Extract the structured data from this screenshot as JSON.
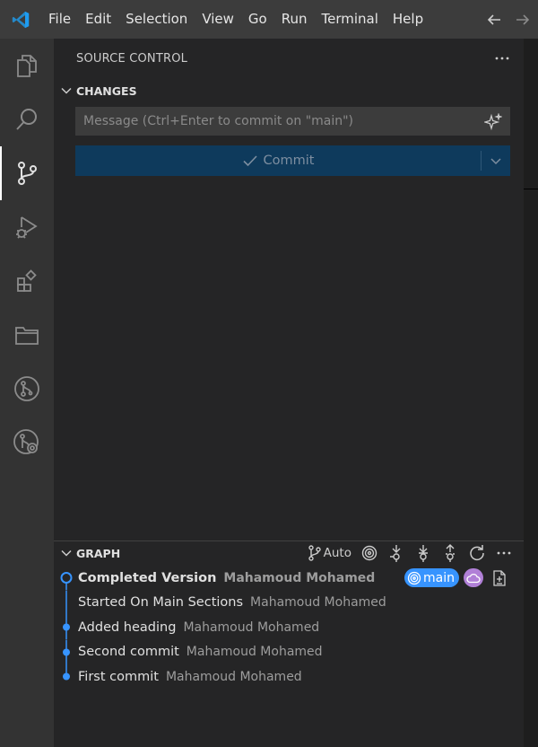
{
  "menu": {
    "items": [
      "File",
      "Edit",
      "Selection",
      "View",
      "Go",
      "Run",
      "Terminal",
      "Help"
    ]
  },
  "activity": {
    "items": [
      {
        "name": "explorer-icon"
      },
      {
        "name": "search-icon"
      },
      {
        "name": "source-control-icon",
        "active": true
      },
      {
        "name": "run-debug-icon"
      },
      {
        "name": "extensions-icon"
      },
      {
        "name": "remote-explorer-icon"
      },
      {
        "name": "github-pr-icon"
      },
      {
        "name": "git-graph-icon"
      }
    ]
  },
  "sidebar": {
    "title": "SOURCE CONTROL",
    "changes_label": "CHANGES",
    "commit": {
      "placeholder": "Message (Ctrl+Enter to commit on \"main\")",
      "button_label": "Commit"
    },
    "graph": {
      "label": "GRAPH",
      "auto_label": "Auto",
      "branch_badge": "main",
      "commits": [
        {
          "message": "Completed Version",
          "author": "Mahamoud Mohamed",
          "head": true
        },
        {
          "message": "Started On Main Sections",
          "author": "Mahamoud Mohamed"
        },
        {
          "message": "Added heading",
          "author": "Mahamoud Mohamed"
        },
        {
          "message": "Second commit",
          "author": "Mahamoud Mohamed"
        },
        {
          "message": "First commit",
          "author": "Mahamoud Mohamed"
        }
      ]
    }
  },
  "colors": {
    "accent": "#3794ff",
    "commit_button": "#0e3a5c",
    "cloud_badge": "#b180d7",
    "titlebar": "#3c3c3c",
    "activitybar": "#333333",
    "sidebar": "#252526"
  }
}
